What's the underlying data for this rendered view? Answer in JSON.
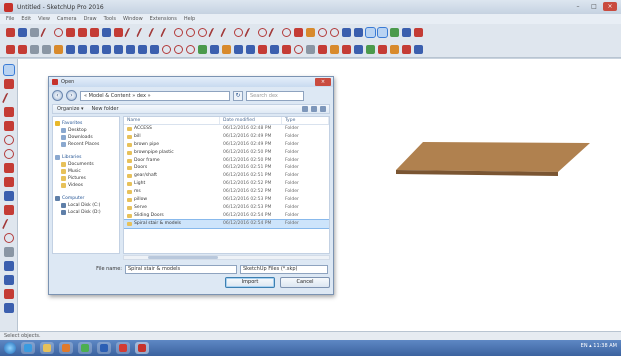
{
  "window": {
    "title": "Untitled - SketchUp Pro 2016",
    "minimize": "–",
    "maximize": "□",
    "close": "×"
  },
  "menu": [
    "File",
    "Edit",
    "View",
    "Camera",
    "Draw",
    "Tools",
    "Window",
    "Extensions",
    "Help"
  ],
  "status_text": "Select objects.",
  "dialog": {
    "title": "Open",
    "close": "×",
    "back": "‹",
    "forward": "›",
    "address": "« Model & Content » dex »",
    "refresh": "↻",
    "search_placeholder": "Search dex",
    "commands": [
      "Organize ▾",
      "New folder"
    ],
    "nav": {
      "favorites": {
        "head": "Favorites",
        "items": [
          "Desktop",
          "Downloads",
          "Recent Places"
        ]
      },
      "libraries": {
        "head": "Libraries",
        "items": [
          "Documents",
          "Music",
          "Pictures",
          "Videos"
        ]
      },
      "computer": {
        "head": "Computer",
        "items": [
          "Local Disk (C:)",
          "Local Disk (D:)"
        ]
      }
    },
    "columns": {
      "name": "Name",
      "date": "Date modified",
      "type": "Type"
    },
    "files": [
      {
        "name": "ACCESS",
        "date": "06/12/2016 02:48 PM",
        "type": "Folder"
      },
      {
        "name": "bill",
        "date": "06/12/2016 02:49 PM",
        "type": "Folder"
      },
      {
        "name": "brown pipe",
        "date": "06/12/2016 02:49 PM",
        "type": "Folder"
      },
      {
        "name": "brownpipe plastic",
        "date": "06/12/2016 02:50 PM",
        "type": "Folder"
      },
      {
        "name": "Door frame",
        "date": "06/12/2016 02:50 PM",
        "type": "Folder"
      },
      {
        "name": "Doors",
        "date": "06/12/2016 02:51 PM",
        "type": "Folder"
      },
      {
        "name": "gear/shaft",
        "date": "06/12/2016 02:51 PM",
        "type": "Folder"
      },
      {
        "name": "Light",
        "date": "06/12/2016 02:52 PM",
        "type": "Folder"
      },
      {
        "name": "ms",
        "date": "06/12/2016 02:52 PM",
        "type": "Folder"
      },
      {
        "name": "pillow",
        "date": "06/12/2016 02:53 PM",
        "type": "Folder"
      },
      {
        "name": "Serve",
        "date": "06/12/2016 02:53 PM",
        "type": "Folder"
      },
      {
        "name": "Sliding Doors",
        "date": "06/12/2016 02:54 PM",
        "type": "Folder"
      },
      {
        "name": "Spiral stair & models",
        "date": "06/12/2016 02:54 PM",
        "type": "Folder"
      }
    ],
    "filename_label": "File name:",
    "filename_value": "Spiral stair & models",
    "filter_value": "SketchUp Files (*.skp)",
    "open_label": "Import",
    "cancel_label": "Cancel"
  },
  "colors": {
    "plane_top": "#b0814f",
    "plane_edge": "#7a5532",
    "taskbar": "#3b629f"
  },
  "taskbar": {
    "tray_text": "EN ▴ 11:38 AM"
  }
}
